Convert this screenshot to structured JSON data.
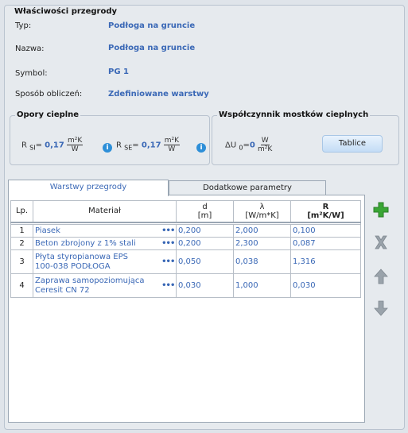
{
  "properties": {
    "title": "Właściwości przegrody",
    "rows": [
      {
        "label": "Typ:",
        "value": "Podłoga na gruncie"
      },
      {
        "label": "Nazwa:",
        "value": "Podłoga na gruncie"
      },
      {
        "label": "Symbol:",
        "value": "PG 1"
      },
      {
        "label": "Sposób obliczeń:",
        "value": "Zdefiniowane warstwy"
      }
    ]
  },
  "thermal_resistance": {
    "title": "Opory cieplne",
    "rsi": {
      "symbol": "R",
      "sub": "SI",
      "eq": "=",
      "value": "0,17",
      "unit_num": "m²K",
      "unit_den": "W"
    },
    "rse": {
      "symbol": "R",
      "sub": "SE",
      "eq": "=",
      "value": "0,17",
      "unit_num": "m²K",
      "unit_den": "W"
    },
    "info_glyph": "i"
  },
  "thermal_bridges": {
    "title": "Współczynnik mostków cieplnych",
    "symbol": "ΔU",
    "sub": "0",
    "eq": "=",
    "value": "0",
    "unit_num": "W",
    "unit_den": "m²K",
    "button_label": "Tablice"
  },
  "tabs": [
    {
      "label": "Warstwy przegrody",
      "active": true
    },
    {
      "label": "Dodatkowe parametry",
      "active": false
    }
  ],
  "table": {
    "headers": {
      "lp": "Lp.",
      "material": "Materiał",
      "d": "d",
      "d_unit": "[m]",
      "lambda": "λ",
      "lambda_unit": "[W/m*K]",
      "r": "R",
      "r_unit": "[m²K/W]"
    },
    "rows": [
      {
        "lp": "1",
        "material_line1": "Piasek",
        "material_line2": "",
        "d": "0,200",
        "lambda": "2,000",
        "r": "0,100"
      },
      {
        "lp": "2",
        "material_line1": "Beton zbrojony z 1% stali",
        "material_line2": "",
        "d": "0,200",
        "lambda": "2,300",
        "r": "0,087"
      },
      {
        "lp": "3",
        "material_line1": "Płyta styropianowa EPS",
        "material_line2": "100-038 PODŁOGA",
        "d": "0,050",
        "lambda": "0,038",
        "r": "1,316"
      },
      {
        "lp": "4",
        "material_line1": "Zaprawa samopoziomująca",
        "material_line2": "Ceresit CN 72",
        "d": "0,030",
        "lambda": "1,000",
        "r": "0,030"
      }
    ],
    "ellipsis": "•••"
  },
  "side_buttons": {
    "add": "plus-icon",
    "delete": "x-icon",
    "up": "arrow-up-icon",
    "down": "arrow-down-icon"
  },
  "colors": {
    "value_blue": "#3a68b6",
    "add_green": "#3aa635",
    "disabled_gray": "#9aa3ab"
  }
}
